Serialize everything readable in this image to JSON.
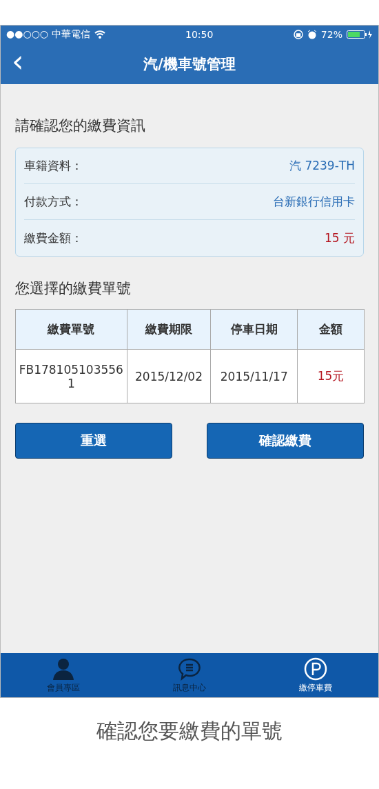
{
  "status_bar": {
    "carrier": "●●○○○ 中華電信",
    "time": "10:50",
    "battery": "72%"
  },
  "nav": {
    "back": "‹",
    "title": "汽/機車號管理"
  },
  "confirm": {
    "heading": "請確認您的繳費資訊",
    "rows": [
      {
        "label": "車籍資料：",
        "value": "汽 7239-TH",
        "kind": "info"
      },
      {
        "label": "付款方式：",
        "value": "台新銀行信用卡",
        "kind": "info"
      },
      {
        "label": "繳費金額：",
        "value": "15 元",
        "kind": "amount"
      }
    ]
  },
  "bills": {
    "heading": "您選擇的繳費單號",
    "table": {
      "columns": [
        "繳費單號",
        "繳費期限",
        "停車日期",
        "金額"
      ],
      "rows": [
        [
          "FB1781051035561",
          "2015/12/02",
          "2015/11/17",
          "15元"
        ]
      ]
    }
  },
  "buttons": [
    "重選",
    "確認繳費"
  ],
  "tab_bar": [
    {
      "label": "會員專區",
      "kind": "member",
      "selected": false
    },
    {
      "label": "訊息中心",
      "kind": "message",
      "selected": false
    },
    {
      "label": "繳停車費",
      "kind": "parking",
      "selected": true
    }
  ],
  "caption": "確認您要繳費的單號"
}
